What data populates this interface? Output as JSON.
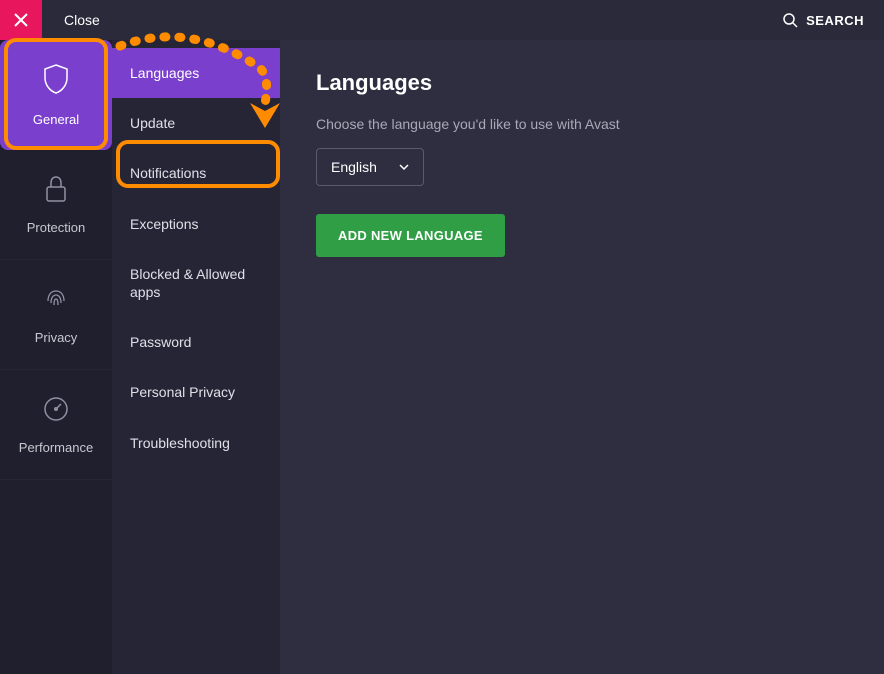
{
  "topBar": {
    "close": "Close",
    "search": "SEARCH"
  },
  "sidebarPrimary": {
    "items": [
      {
        "id": "general",
        "label": "General",
        "active": true
      },
      {
        "id": "protection",
        "label": "Protection",
        "active": false
      },
      {
        "id": "privacy",
        "label": "Privacy",
        "active": false
      },
      {
        "id": "performance",
        "label": "Performance",
        "active": false
      }
    ]
  },
  "sidebarSecondary": {
    "items": [
      {
        "id": "languages",
        "label": "Languages",
        "active": true
      },
      {
        "id": "update",
        "label": "Update",
        "active": false
      },
      {
        "id": "notifications",
        "label": "Notifications",
        "active": false
      },
      {
        "id": "exceptions",
        "label": "Exceptions",
        "active": false
      },
      {
        "id": "blocked-allowed",
        "label": "Blocked & Allowed apps",
        "active": false
      },
      {
        "id": "password",
        "label": "Password",
        "active": false
      },
      {
        "id": "personal-privacy",
        "label": "Personal Privacy",
        "active": false
      },
      {
        "id": "troubleshooting",
        "label": "Troubleshooting",
        "active": false
      }
    ]
  },
  "content": {
    "title": "Languages",
    "description": "Choose the language you'd like to use with Avast",
    "selectedLanguage": "English",
    "addLanguageBtn": "ADD NEW LANGUAGE"
  },
  "annotations": {
    "highlightColor": "#ff8c00",
    "highlights": [
      "general-tab",
      "notifications-subitem"
    ],
    "arrow": {
      "from": "general-tab",
      "to": "notifications-subitem",
      "style": "dashed-curved"
    }
  }
}
